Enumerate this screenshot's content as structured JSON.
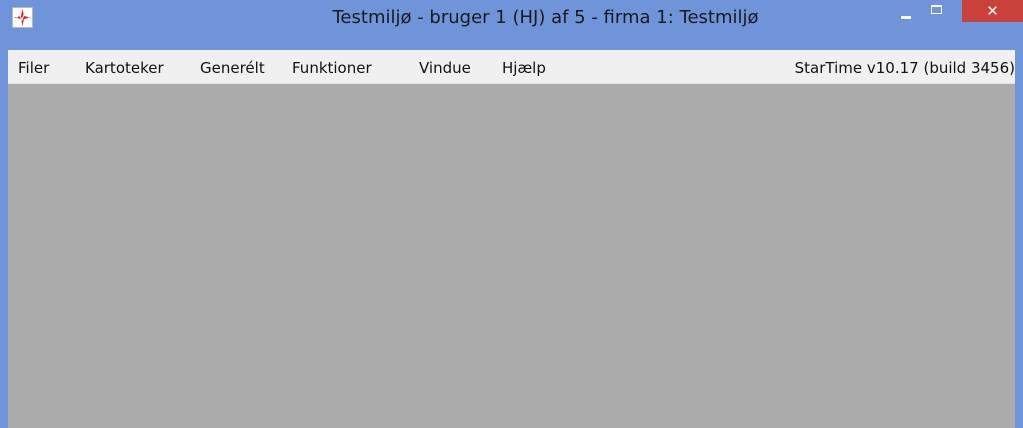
{
  "window": {
    "title": "Testmiljø - bruger 1 (HJ) af 5 - firma 1: Testmiljø",
    "frame_color": "#6f94d9",
    "close_color": "#c8413a",
    "workspace_color": "#ababab",
    "icons": {
      "app": "startime-logo-icon",
      "minimize": "minimize-icon",
      "maximize": "maximize-icon",
      "close": "close-icon"
    },
    "close_glyph": "✕"
  },
  "menu": {
    "items": [
      {
        "label": "Filer"
      },
      {
        "label": "Kartoteker"
      },
      {
        "label": "Generélt"
      },
      {
        "label": "Funktioner"
      },
      {
        "label": "Vindue"
      },
      {
        "label": "Hjælp"
      }
    ],
    "version": "StarTime v10.17 (build 3456)"
  }
}
